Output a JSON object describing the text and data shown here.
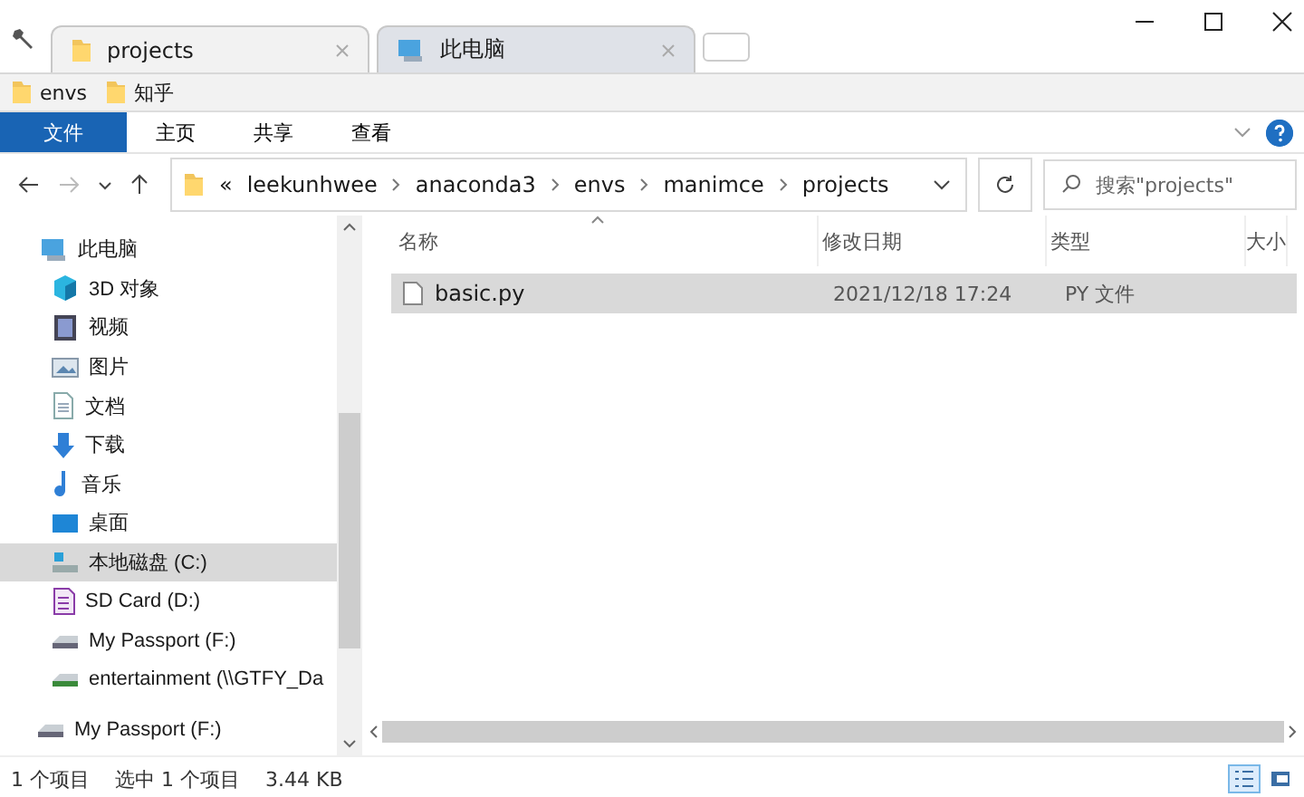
{
  "tabs": [
    {
      "label": "projects",
      "kind": "folder",
      "selected": true
    },
    {
      "label": "此电脑",
      "kind": "pc",
      "selected": false
    }
  ],
  "bookmarks": [
    {
      "label": "envs"
    },
    {
      "label": "知乎"
    }
  ],
  "ribbon": [
    {
      "label": "文件",
      "selected": true
    },
    {
      "label": "主页",
      "selected": false
    },
    {
      "label": "共享",
      "selected": false
    },
    {
      "label": "查看",
      "selected": false
    }
  ],
  "address": {
    "overflow": "«",
    "crumbs": [
      "leekunhwee",
      "anaconda3",
      "envs",
      "manimce",
      "projects"
    ]
  },
  "search": {
    "placeholder": "搜索\"projects\""
  },
  "nav": [
    {
      "label": "此电脑",
      "kind": "pc",
      "selected": false,
      "children": [
        {
          "label": "3D 对象",
          "kind": "cube",
          "selected": false
        },
        {
          "label": "视频",
          "kind": "video",
          "selected": false
        },
        {
          "label": "图片",
          "kind": "picture",
          "selected": false
        },
        {
          "label": "文档",
          "kind": "doc",
          "selected": false
        },
        {
          "label": "下载",
          "kind": "download",
          "selected": false
        },
        {
          "label": "音乐",
          "kind": "music",
          "selected": false
        },
        {
          "label": "桌面",
          "kind": "desktop",
          "selected": false
        },
        {
          "label": "本地磁盘 (C:)",
          "kind": "disk",
          "selected": true
        },
        {
          "label": "SD Card (D:)",
          "kind": "sd",
          "selected": false
        },
        {
          "label": "My Passport (F:)",
          "kind": "drive",
          "selected": false
        },
        {
          "label": "entertainment (\\\\GTFY_Da",
          "kind": "netdrive",
          "selected": false
        }
      ]
    },
    {
      "label": "My Passport (F:)",
      "kind": "drive",
      "selected": false
    }
  ],
  "table": {
    "columns": [
      "名称",
      "修改日期",
      "类型",
      "大小"
    ],
    "rows": [
      {
        "name": "basic.py",
        "modified": "2021/12/18 17:24",
        "type": "PY 文件",
        "selected": true
      }
    ]
  },
  "status_bar": {
    "count": "1 个项目",
    "selection": "选中 1 个项目",
    "size": "3.44 KB",
    "views": [
      {
        "kind": "details",
        "selected": true
      },
      {
        "kind": "large",
        "selected": false
      }
    ]
  }
}
